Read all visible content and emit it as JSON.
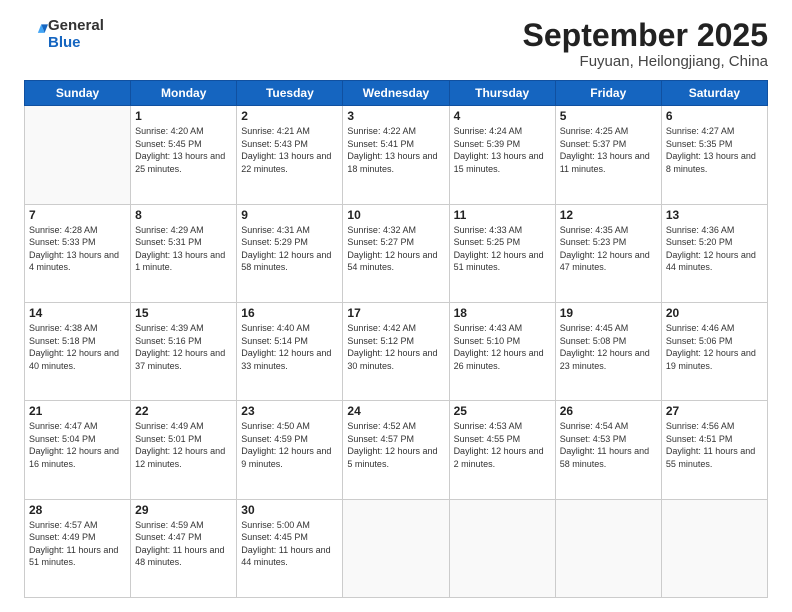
{
  "header": {
    "logo_line1": "General",
    "logo_line2": "Blue",
    "title": "September 2025",
    "location": "Fuyuan, Heilongjiang, China"
  },
  "weekdays": [
    "Sunday",
    "Monday",
    "Tuesday",
    "Wednesday",
    "Thursday",
    "Friday",
    "Saturday"
  ],
  "weeks": [
    [
      {
        "day": "",
        "info": ""
      },
      {
        "day": "1",
        "info": "Sunrise: 4:20 AM\nSunset: 5:45 PM\nDaylight: 13 hours\nand 25 minutes."
      },
      {
        "day": "2",
        "info": "Sunrise: 4:21 AM\nSunset: 5:43 PM\nDaylight: 13 hours\nand 22 minutes."
      },
      {
        "day": "3",
        "info": "Sunrise: 4:22 AM\nSunset: 5:41 PM\nDaylight: 13 hours\nand 18 minutes."
      },
      {
        "day": "4",
        "info": "Sunrise: 4:24 AM\nSunset: 5:39 PM\nDaylight: 13 hours\nand 15 minutes."
      },
      {
        "day": "5",
        "info": "Sunrise: 4:25 AM\nSunset: 5:37 PM\nDaylight: 13 hours\nand 11 minutes."
      },
      {
        "day": "6",
        "info": "Sunrise: 4:27 AM\nSunset: 5:35 PM\nDaylight: 13 hours\nand 8 minutes."
      }
    ],
    [
      {
        "day": "7",
        "info": "Sunrise: 4:28 AM\nSunset: 5:33 PM\nDaylight: 13 hours\nand 4 minutes."
      },
      {
        "day": "8",
        "info": "Sunrise: 4:29 AM\nSunset: 5:31 PM\nDaylight: 13 hours\nand 1 minute."
      },
      {
        "day": "9",
        "info": "Sunrise: 4:31 AM\nSunset: 5:29 PM\nDaylight: 12 hours\nand 58 minutes."
      },
      {
        "day": "10",
        "info": "Sunrise: 4:32 AM\nSunset: 5:27 PM\nDaylight: 12 hours\nand 54 minutes."
      },
      {
        "day": "11",
        "info": "Sunrise: 4:33 AM\nSunset: 5:25 PM\nDaylight: 12 hours\nand 51 minutes."
      },
      {
        "day": "12",
        "info": "Sunrise: 4:35 AM\nSunset: 5:23 PM\nDaylight: 12 hours\nand 47 minutes."
      },
      {
        "day": "13",
        "info": "Sunrise: 4:36 AM\nSunset: 5:20 PM\nDaylight: 12 hours\nand 44 minutes."
      }
    ],
    [
      {
        "day": "14",
        "info": "Sunrise: 4:38 AM\nSunset: 5:18 PM\nDaylight: 12 hours\nand 40 minutes."
      },
      {
        "day": "15",
        "info": "Sunrise: 4:39 AM\nSunset: 5:16 PM\nDaylight: 12 hours\nand 37 minutes."
      },
      {
        "day": "16",
        "info": "Sunrise: 4:40 AM\nSunset: 5:14 PM\nDaylight: 12 hours\nand 33 minutes."
      },
      {
        "day": "17",
        "info": "Sunrise: 4:42 AM\nSunset: 5:12 PM\nDaylight: 12 hours\nand 30 minutes."
      },
      {
        "day": "18",
        "info": "Sunrise: 4:43 AM\nSunset: 5:10 PM\nDaylight: 12 hours\nand 26 minutes."
      },
      {
        "day": "19",
        "info": "Sunrise: 4:45 AM\nSunset: 5:08 PM\nDaylight: 12 hours\nand 23 minutes."
      },
      {
        "day": "20",
        "info": "Sunrise: 4:46 AM\nSunset: 5:06 PM\nDaylight: 12 hours\nand 19 minutes."
      }
    ],
    [
      {
        "day": "21",
        "info": "Sunrise: 4:47 AM\nSunset: 5:04 PM\nDaylight: 12 hours\nand 16 minutes."
      },
      {
        "day": "22",
        "info": "Sunrise: 4:49 AM\nSunset: 5:01 PM\nDaylight: 12 hours\nand 12 minutes."
      },
      {
        "day": "23",
        "info": "Sunrise: 4:50 AM\nSunset: 4:59 PM\nDaylight: 12 hours\nand 9 minutes."
      },
      {
        "day": "24",
        "info": "Sunrise: 4:52 AM\nSunset: 4:57 PM\nDaylight: 12 hours\nand 5 minutes."
      },
      {
        "day": "25",
        "info": "Sunrise: 4:53 AM\nSunset: 4:55 PM\nDaylight: 12 hours\nand 2 minutes."
      },
      {
        "day": "26",
        "info": "Sunrise: 4:54 AM\nSunset: 4:53 PM\nDaylight: 11 hours\nand 58 minutes."
      },
      {
        "day": "27",
        "info": "Sunrise: 4:56 AM\nSunset: 4:51 PM\nDaylight: 11 hours\nand 55 minutes."
      }
    ],
    [
      {
        "day": "28",
        "info": "Sunrise: 4:57 AM\nSunset: 4:49 PM\nDaylight: 11 hours\nand 51 minutes."
      },
      {
        "day": "29",
        "info": "Sunrise: 4:59 AM\nSunset: 4:47 PM\nDaylight: 11 hours\nand 48 minutes."
      },
      {
        "day": "30",
        "info": "Sunrise: 5:00 AM\nSunset: 4:45 PM\nDaylight: 11 hours\nand 44 minutes."
      },
      {
        "day": "",
        "info": ""
      },
      {
        "day": "",
        "info": ""
      },
      {
        "day": "",
        "info": ""
      },
      {
        "day": "",
        "info": ""
      }
    ]
  ]
}
